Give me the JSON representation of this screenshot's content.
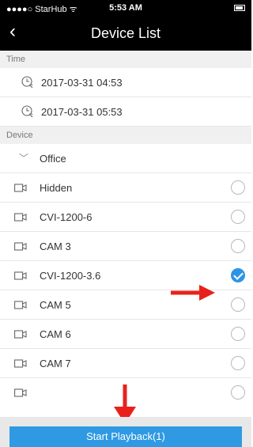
{
  "status_bar": {
    "carrier": "●●●●○ StarHub ᯤ",
    "time": "5:53 AM"
  },
  "nav": {
    "title": "Device List",
    "back_glyph": "‹"
  },
  "time_section": {
    "header": "Time",
    "start": "2017-03-31 04:53",
    "end": "2017-03-31 05:53"
  },
  "device_section": {
    "header": "Device",
    "group": "Office",
    "devices": [
      {
        "name": "Hidden",
        "selected": false
      },
      {
        "name": "CVI-1200-6",
        "selected": false
      },
      {
        "name": "CAM 3",
        "selected": false
      },
      {
        "name": "CVI-1200-3.6",
        "selected": true
      },
      {
        "name": "CAM 5",
        "selected": false
      },
      {
        "name": "CAM 6",
        "selected": false
      },
      {
        "name": "CAM 7",
        "selected": false
      },
      {
        "name": "",
        "selected": false
      }
    ]
  },
  "footer": {
    "button_label": "Start Playback(1)"
  },
  "colors": {
    "accent": "#2f9ae3",
    "annotation_arrow": "#e8221b",
    "nav_bg": "#000000"
  }
}
